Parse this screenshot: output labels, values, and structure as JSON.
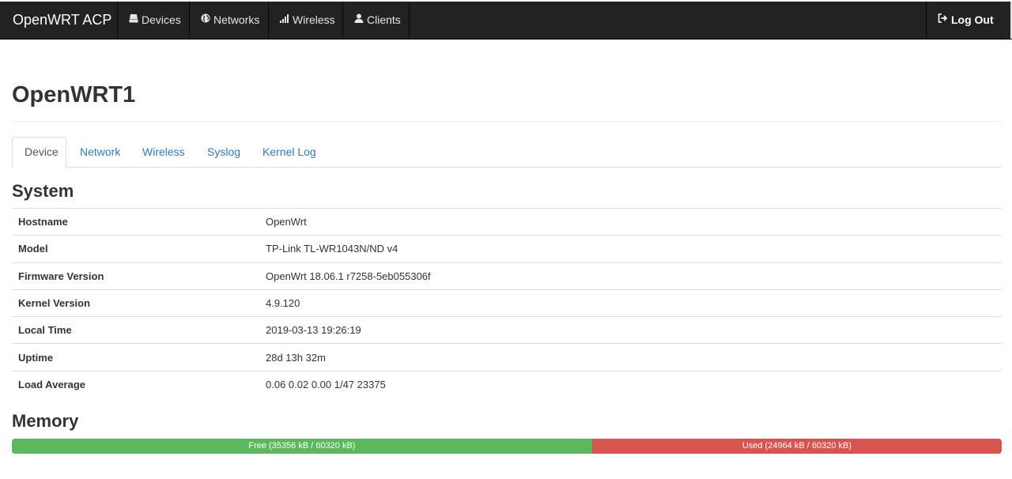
{
  "navbar": {
    "brand": "OpenWRT ACP",
    "items": [
      {
        "label": "Devices",
        "icon": "hdd-icon"
      },
      {
        "label": "Networks",
        "icon": "globe-icon"
      },
      {
        "label": "Wireless",
        "icon": "signal-icon"
      },
      {
        "label": "Clients",
        "icon": "user-icon"
      }
    ],
    "logout": {
      "label": "Log Out",
      "icon": "log-out-icon"
    }
  },
  "page": {
    "title": "OpenWRT1"
  },
  "tabs": [
    {
      "label": "Device",
      "active": true
    },
    {
      "label": "Network",
      "active": false
    },
    {
      "label": "Wireless",
      "active": false
    },
    {
      "label": "Syslog",
      "active": false
    },
    {
      "label": "Kernel Log",
      "active": false
    }
  ],
  "system": {
    "title": "System",
    "rows": [
      {
        "key": "Hostname",
        "value": "OpenWrt"
      },
      {
        "key": "Model",
        "value": "TP-Link TL-WR1043N/ND v4"
      },
      {
        "key": "Firmware Version",
        "value": "OpenWrt 18.06.1 r7258-5eb055306f"
      },
      {
        "key": "Kernel Version",
        "value": "4.9.120"
      },
      {
        "key": "Local Time",
        "value": "2019-03-13 19:26:19"
      },
      {
        "key": "Uptime",
        "value": "28d 13h 32m"
      },
      {
        "key": "Load Average",
        "value": "0.06 0.02 0.00 1/47 23375"
      }
    ]
  },
  "memory": {
    "title": "Memory",
    "free_label": "Free (35356 kB / 60320 kB)",
    "used_label": "Used (24964 kB / 60320 kB)",
    "free_kb": 35356,
    "used_kb": 24964,
    "total_kb": 60320,
    "free_color": "#5cb85c",
    "used_color": "#d9534f"
  },
  "colors": {
    "navbar_bg": "#222222",
    "link": "#337ab7"
  }
}
